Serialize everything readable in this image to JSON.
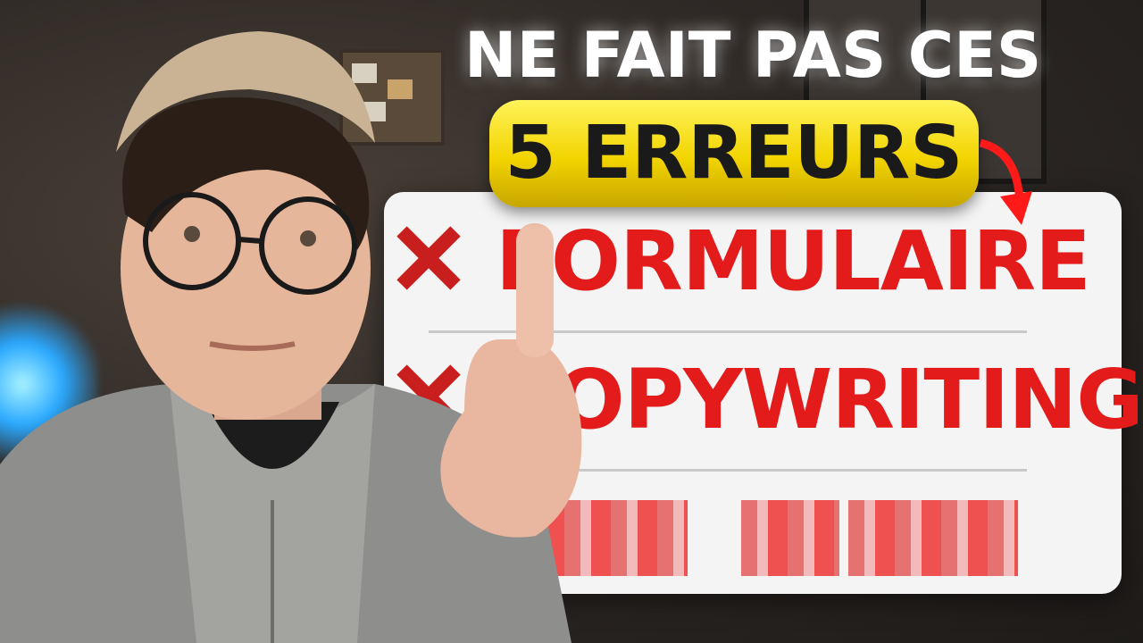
{
  "headline": {
    "line1": "NE FAIT PAS CES",
    "highlight": "5 ERREURS"
  },
  "errors": [
    {
      "label": "FORMULAIRE",
      "icon": "x-mark-icon"
    },
    {
      "label": "COPYWRITING",
      "icon": "x-mark-icon"
    },
    {
      "label": "",
      "icon": "x-mark-icon",
      "pixelated": true
    }
  ],
  "colors": {
    "error_red": "#e31b1b",
    "highlight_yellow": "#f2d400",
    "card_bg": "#f4f4f4"
  }
}
